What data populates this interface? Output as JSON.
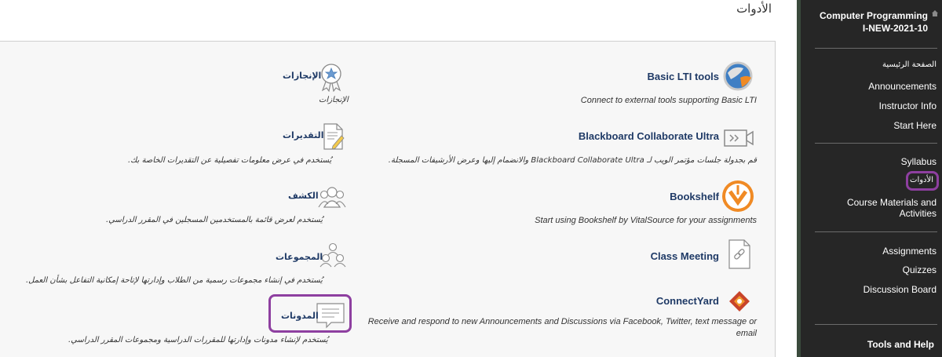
{
  "page": {
    "title": "الأدوات"
  },
  "tools_left": [
    {
      "title": "Basic LTI tools",
      "desc": "Connect to external tools supporting Basic LTI",
      "icon": "globe-icon"
    },
    {
      "title": "Blackboard Collaborate Ultra",
      "desc": "قم بجدولة جلسات مؤتمر الويب لـ Blackboard Collaborate Ultra والانضمام إليها وعرض الأرشيفات المسجلة.",
      "icon": "collaborate-icon"
    },
    {
      "title": "Bookshelf",
      "desc": "Start using Bookshelf by VitalSource for your assignments",
      "icon": "bookshelf-icon"
    },
    {
      "title": "Class Meeting",
      "desc": "",
      "icon": "link-document-icon"
    },
    {
      "title": "ConnectYard",
      "desc_line1": "Receive and respond to new Announcements and Discussions via Facebook, Twitter, text message or",
      "desc_line2": "email",
      "icon": "connectyard-icon"
    }
  ],
  "tools_right": [
    {
      "title": "الإنجازات",
      "desc": "الإنجازات",
      "icon": "achievement-icon"
    },
    {
      "title": "التقديرات",
      "desc": "يُستخدم في عرض معلومات تفصيلية عن التقديرات الخاصة بك.",
      "icon": "grades-icon"
    },
    {
      "title": "الكشف",
      "desc": "يُستخدم لعرض قائمة بالمستخدمين المسجلين في المقرر الدراسي.",
      "icon": "roster-icon"
    },
    {
      "title": "المجموعات",
      "desc": "يُستخدم في إنشاء مجموعات رسمية من الطلاب وإدارتها لإتاحة إمكانية التفاعل بشأن العمل.",
      "icon": "groups-icon"
    },
    {
      "title": "المدونات",
      "desc": "يُستخدم لإنشاء مدونات وإدارتها للمقررات الدراسية ومجموعات المقرر الدراسي.",
      "icon": "blogs-icon"
    }
  ],
  "sidebar": {
    "course_title_line1": "Computer Programming",
    "course_title_line2": "I-NEW-2021-10",
    "items": [
      {
        "label": "الصفحة الرئيسية"
      },
      {
        "label": "Announcements"
      },
      {
        "label": "Instructor Info"
      },
      {
        "label": "Start Here"
      },
      {
        "label": "Syllabus"
      },
      {
        "label": "الأدوات"
      },
      {
        "label": "Course Materials and Activities"
      },
      {
        "label": "Assignments"
      },
      {
        "label": "Quizzes"
      },
      {
        "label": "Discussion Board"
      }
    ],
    "tools_help": "Tools and Help"
  },
  "colors": {
    "sidebar_bg": "#262626",
    "link_title": "#1f3a66",
    "highlight": "#8e3fa0"
  }
}
